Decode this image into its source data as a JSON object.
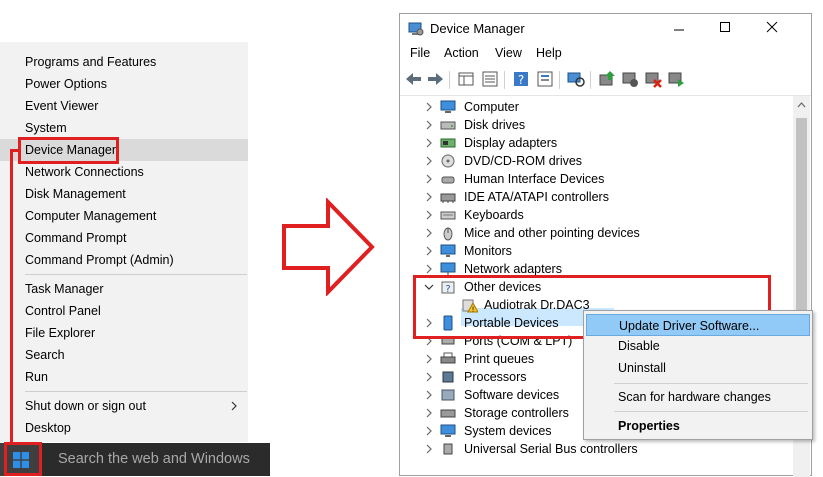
{
  "winx_menu": {
    "items": [
      {
        "label": "Programs and Features"
      },
      {
        "label": "Power Options"
      },
      {
        "label": "Event Viewer"
      },
      {
        "label": "System"
      },
      {
        "label": "Device Manager"
      },
      {
        "label": "Network Connections"
      },
      {
        "label": "Disk Management"
      },
      {
        "label": "Computer Management"
      },
      {
        "label": "Command Prompt"
      },
      {
        "label": "Command Prompt (Admin)"
      },
      {
        "label": "Task Manager"
      },
      {
        "label": "Control Panel"
      },
      {
        "label": "File Explorer"
      },
      {
        "label": "Search"
      },
      {
        "label": "Run"
      },
      {
        "label": "Shut down or sign out"
      },
      {
        "label": "Desktop"
      }
    ],
    "highlighted": "Device Manager"
  },
  "taskbar": {
    "search_placeholder": "Search the web and Windows"
  },
  "device_manager": {
    "title": "Device Manager",
    "menu": [
      "File",
      "Action",
      "View",
      "Help"
    ],
    "tree": [
      {
        "label": "Computer",
        "expanded": false,
        "icon": "computer-icon"
      },
      {
        "label": "Disk drives",
        "expanded": false,
        "icon": "disk-drive-icon"
      },
      {
        "label": "Display adapters",
        "expanded": false,
        "icon": "display-adapter-icon"
      },
      {
        "label": "DVD/CD-ROM drives",
        "expanded": false,
        "icon": "dvd-drive-icon"
      },
      {
        "label": "Human Interface Devices",
        "expanded": false,
        "icon": "hid-icon"
      },
      {
        "label": "IDE ATA/ATAPI controllers",
        "expanded": false,
        "icon": "ide-controller-icon"
      },
      {
        "label": "Keyboards",
        "expanded": false,
        "icon": "keyboard-icon"
      },
      {
        "label": "Mice and other pointing devices",
        "expanded": false,
        "icon": "mouse-icon"
      },
      {
        "label": "Monitors",
        "expanded": false,
        "icon": "monitor-icon"
      },
      {
        "label": "Network adapters",
        "expanded": false,
        "icon": "network-adapter-icon"
      },
      {
        "label": "Other devices",
        "expanded": true,
        "icon": "unknown-device-icon"
      },
      {
        "label": "Audiotrak Dr.DAC3",
        "child": true,
        "selected": true,
        "icon": "warning-device-icon"
      },
      {
        "label": "Portable Devices",
        "expanded": false,
        "icon": "portable-device-icon"
      },
      {
        "label": "Ports (COM & LPT)",
        "expanded": false,
        "icon": "port-icon"
      },
      {
        "label": "Print queues",
        "expanded": false,
        "icon": "printer-icon"
      },
      {
        "label": "Processors",
        "expanded": false,
        "icon": "processor-icon"
      },
      {
        "label": "Software devices",
        "expanded": false,
        "icon": "software-device-icon"
      },
      {
        "label": "Storage controllers",
        "expanded": false,
        "icon": "storage-controller-icon"
      },
      {
        "label": "System devices",
        "expanded": false,
        "icon": "system-device-icon"
      },
      {
        "label": "Universal Serial Bus controllers",
        "expanded": false,
        "icon": "usb-icon"
      }
    ]
  },
  "context_menu": {
    "items": [
      {
        "label": "Update Driver Software...",
        "highlighted": true
      },
      {
        "label": "Disable"
      },
      {
        "label": "Uninstall"
      },
      {
        "label": "Scan for hardware changes"
      },
      {
        "label": "Properties",
        "bold": true
      }
    ]
  },
  "colors": {
    "highlight_red": "#e02020",
    "menu_bg": "#f2f2f2",
    "selection_blue": "#cce8ff",
    "context_highlight": "#91c9f7"
  }
}
